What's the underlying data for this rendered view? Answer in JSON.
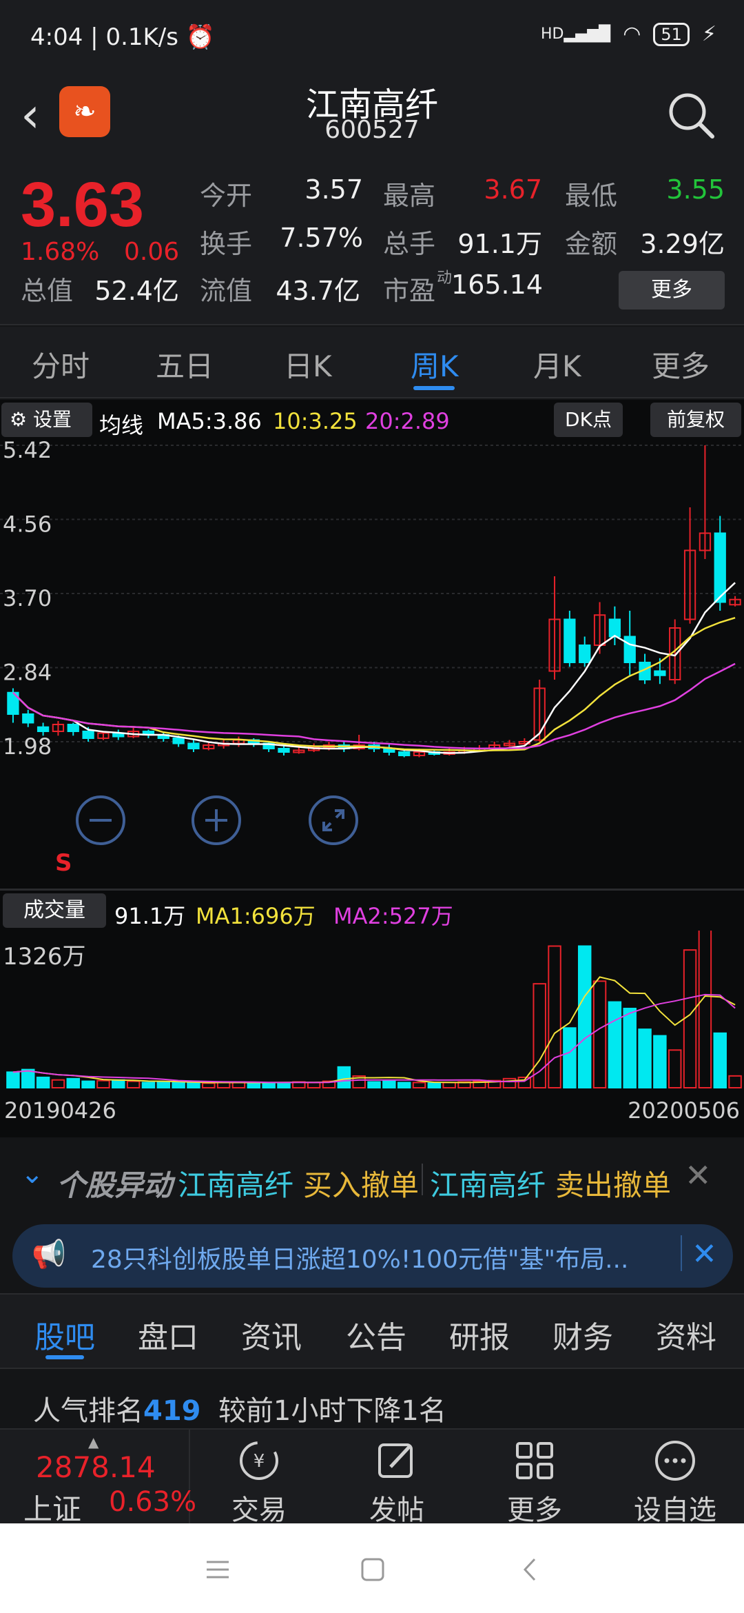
{
  "status": {
    "time": "4:04",
    "net": "0.1K/s",
    "hd": "HD",
    "battery": "51"
  },
  "header": {
    "name": "江南高纤",
    "code": "600527"
  },
  "quote": {
    "price": "3.63",
    "change_pct": "1.68%",
    "change": "0.06",
    "fields": [
      {
        "label": "今开",
        "value": "3.57",
        "color": "#f0f0f0"
      },
      {
        "label": "最高",
        "value": "3.67",
        "color": "#e8222a"
      },
      {
        "label": "最低",
        "value": "3.55",
        "color": "#22c43a"
      },
      {
        "label": "换手",
        "value": "7.57%",
        "color": "#f0f0f0"
      },
      {
        "label": "总手",
        "value": "91.1万",
        "color": "#f0f0f0"
      },
      {
        "label": "金额",
        "value": "3.29亿",
        "color": "#f0f0f0"
      },
      {
        "label": "总值",
        "value": "52.4亿",
        "color": "#f0f0f0"
      },
      {
        "label": "流值",
        "value": "43.7亿",
        "color": "#f0f0f0"
      },
      {
        "label": "市盈",
        "sup": "动",
        "value": "165.14",
        "color": "#f0f0f0"
      }
    ],
    "more": "更多"
  },
  "tabs": {
    "items": [
      "分时",
      "五日",
      "日K",
      "周K",
      "月K",
      "更多"
    ],
    "active": "周K"
  },
  "ma_bar": {
    "settings": "设置",
    "label": "均线",
    "ma5": "MA5:3.86",
    "ma10": "10:3.25",
    "ma20": "20:2.89",
    "dk": "DK点",
    "fq": "前复权"
  },
  "chart_data": [
    {
      "type": "candlestick",
      "title": "",
      "y_ticks": [
        "5.42",
        "4.56",
        "3.70",
        "2.84",
        "1.98"
      ],
      "ylim": [
        1.98,
        5.42
      ],
      "x_start": "20190426",
      "x_end": "20200506",
      "marker": "S",
      "colors": {
        "up": "#e8222a",
        "down": "#00e8f0",
        "ma5": "#ffffff",
        "ma10": "#f2e23c",
        "ma20": "#e040e0"
      }
    },
    {
      "type": "bar",
      "title": "成交量",
      "legend": {
        "vol": "91.1万",
        "ma1": "MA1:696万",
        "ma2": "MA2:527万"
      },
      "y_max_label": "1326万",
      "ylim": [
        0,
        1326
      ]
    }
  ],
  "alert": {
    "label": "个股异动",
    "items": [
      {
        "name": "江南高纤",
        "action": "买入撤单"
      },
      {
        "name": "江南高纤",
        "action": "卖出撤单"
      }
    ]
  },
  "banner": {
    "text": "28只科创板股单日涨超10%!100元借\"基\"布局..."
  },
  "sub_tabs": {
    "items": [
      "股吧",
      "盘口",
      "资讯",
      "公告",
      "研报",
      "财务",
      "资料"
    ],
    "active": "股吧"
  },
  "popularity": {
    "label": "人气排名",
    "rank": "419",
    "note": "较前1小时下降1名"
  },
  "bottom": {
    "index_value": "2878.14",
    "index_name": "上证",
    "index_pct": "0.63%",
    "nav": [
      "交易",
      "发帖",
      "更多",
      "设自选"
    ]
  }
}
